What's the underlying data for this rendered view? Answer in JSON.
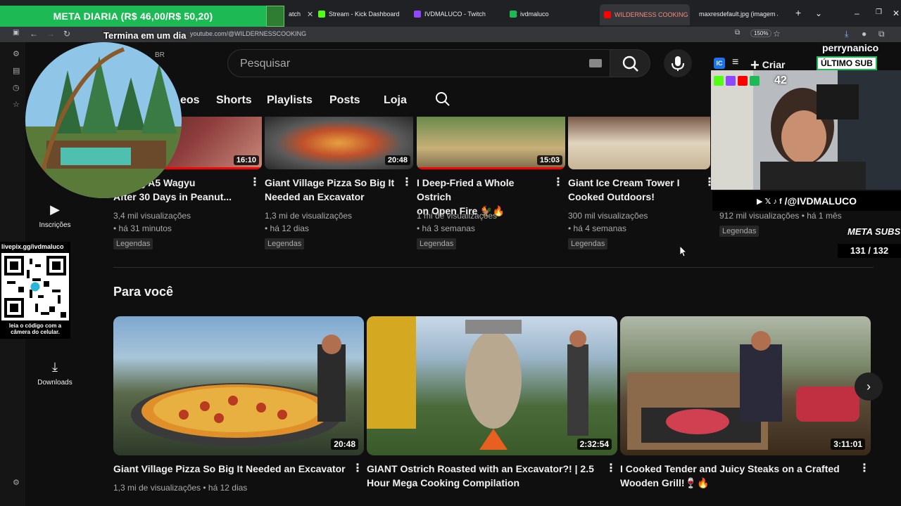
{
  "browser": {
    "tabs": [
      {
        "label": "atch"
      },
      {
        "label": "Stream - Kick Dashboard"
      },
      {
        "label": "IVDMALUCO - Twitch"
      },
      {
        "label": "ivdmaluco"
      },
      {
        "label": "WILDERNESS COOKING - Y"
      },
      {
        "label": "maxresdefault.jpg (imagem JPE"
      }
    ],
    "url": "youtube.com/@WILDERNESSCOOKING",
    "zoom": "150%"
  },
  "overlay": {
    "meta_diaria": "META DIARIA (R$ 46,00/R$ 50,20)",
    "termina": "Termina em um dia",
    "perry": "perrynanico",
    "ultimo_sub": "ÚLTIMO SUB",
    "count": "42",
    "social": "/@IVDMALUCO",
    "meta_subs_label": "META SUBS",
    "meta_subs_count": "131 / 132",
    "qr_url": "livepix.gg/ivdmaluco",
    "qr_caption": "leia o código com a câmera do celular."
  },
  "header": {
    "search_placeholder": "Pesquisar",
    "create_label": "Criar",
    "region": "BR"
  },
  "channel_tabs": [
    "eos",
    "Shorts",
    "Playlists",
    "Posts",
    "Loja"
  ],
  "sidebar": {
    "subscriptions": "Inscrições",
    "downloads": "Downloads"
  },
  "top_videos": [
    {
      "title_line1": "ooking A5 Wagyu",
      "title_line2": "After 30 Days in Peanut...",
      "views": "3,4 mil visualizações",
      "age": "• há 31 minutos",
      "badge": "Legendas",
      "duration": "16:10"
    },
    {
      "title_line1": "Giant Village Pizza So Big It",
      "title_line2": "Needed an Excavator",
      "views": "1,3 mi de visualizações",
      "age": "• há 12 dias",
      "badge": "Legendas",
      "duration": "20:48"
    },
    {
      "title_line1": "I Deep-Fried a Whole Ostrich",
      "title_line2": "on Open Fire 🐓🔥",
      "views": "1 mi de visualizações",
      "age": "• há 3 semanas",
      "badge": "Legendas",
      "duration": "15:03"
    },
    {
      "title_line1": "Giant Ice Cream Tower I",
      "title_line2": "Cooked Outdoors!",
      "views": "300 mil visualizações",
      "age": "• há 4 semanas",
      "badge": "Legendas",
      "duration": ""
    },
    {
      "title_line1": "",
      "title_line2": "",
      "views": "912 mil visualizações • há 1 mês",
      "age": "",
      "badge": "Legendas",
      "duration": ""
    }
  ],
  "for_you": {
    "title": "Para você",
    "videos": [
      {
        "title_line1": "Giant Village Pizza So Big It Needed an Excavator",
        "title_line2": "",
        "meta": "1,3 mi de visualizações • há 12 dias",
        "duration": "20:48"
      },
      {
        "title_line1": "GIANT Ostrich Roasted with an Excavator?! | 2.5",
        "title_line2": "Hour Mega Cooking Compilation",
        "meta": "",
        "duration": "2:32:54"
      },
      {
        "title_line1": "I Cooked Tender and Juicy Steaks on a Crafted",
        "title_line2": "Wooden Grill!🍷🔥",
        "meta": "",
        "duration": "3:11:01"
      }
    ]
  }
}
